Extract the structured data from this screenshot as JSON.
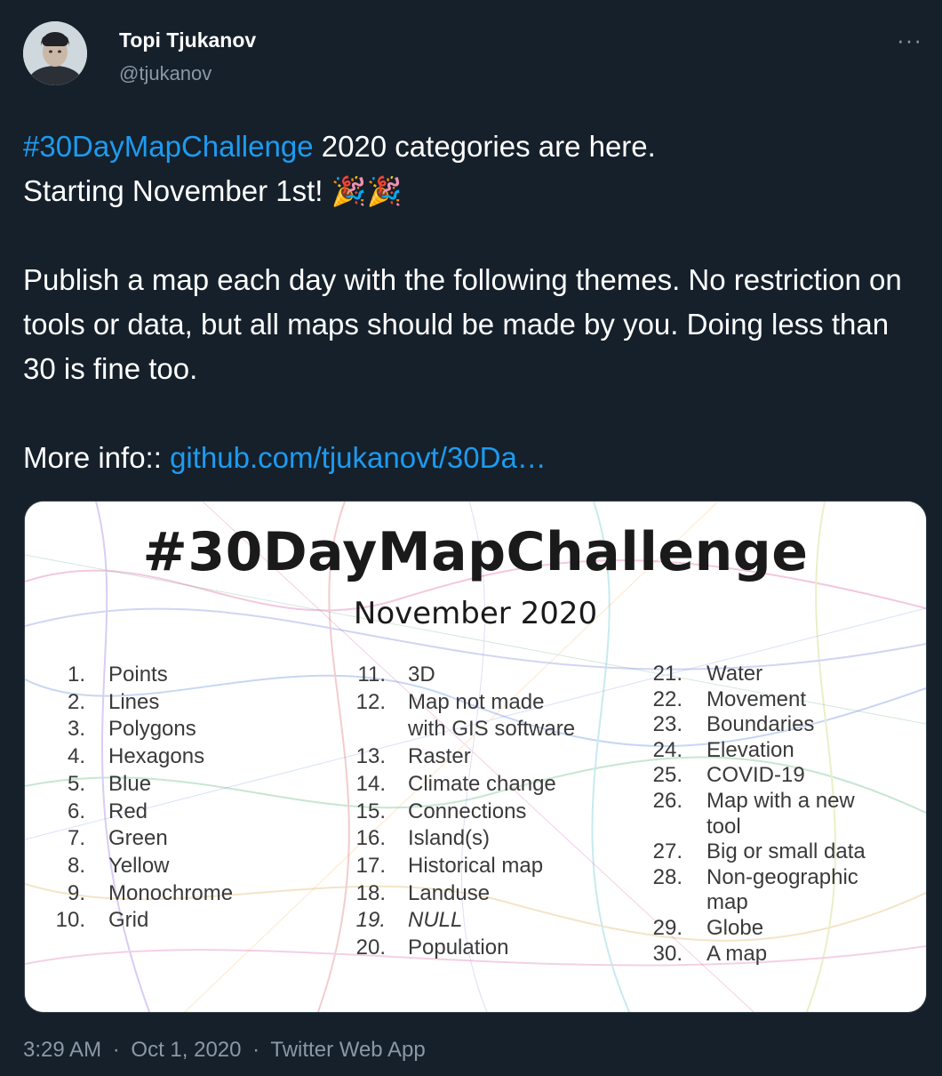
{
  "author": {
    "name": "Topi Tjukanov",
    "handle": "@tjukanov",
    "more_label": "···"
  },
  "tweet": {
    "hashtag": "#30DayMapChallenge",
    "line1_rest": " 2020 categories are here.",
    "line2": "Starting November 1st! ",
    "emoji": "🎉🎉",
    "para2": "Publish a map each day with the following themes. No restriction on tools or data, but all maps should be made by you. Doing less than 30 is fine too.",
    "more_info_label": "More info:: ",
    "link_text": "github.com/tjukanovt/30Da…"
  },
  "card": {
    "title": "#30DayMapChallenge",
    "subtitle": "November 2020",
    "col1": [
      {
        "num": "1.",
        "label": "Points"
      },
      {
        "num": "2.",
        "label": "Lines"
      },
      {
        "num": "3.",
        "label": "Polygons"
      },
      {
        "num": "4.",
        "label": "Hexagons"
      },
      {
        "num": "5.",
        "label": "Blue"
      },
      {
        "num": "6.",
        "label": "Red"
      },
      {
        "num": "7.",
        "label": "Green"
      },
      {
        "num": "8.",
        "label": "Yellow"
      },
      {
        "num": "9.",
        "label": "Monochrome"
      },
      {
        "num": "10.",
        "label": "Grid"
      }
    ],
    "col2": [
      {
        "num": "11.",
        "label": "3D"
      },
      {
        "num": "12.",
        "label": "Map not made"
      },
      {
        "num": "",
        "label": "with GIS software"
      },
      {
        "num": "13.",
        "label": "Raster"
      },
      {
        "num": "14.",
        "label": "Climate change"
      },
      {
        "num": "15.",
        "label": "Connections"
      },
      {
        "num": "16.",
        "label": "Island(s)"
      },
      {
        "num": "17.",
        "label": "Historical map"
      },
      {
        "num": "18.",
        "label": "Landuse"
      },
      {
        "num": "19.",
        "label": "NULL"
      },
      {
        "num": "20.",
        "label": "Population"
      }
    ],
    "col3": [
      {
        "num": "21.",
        "label": "Water"
      },
      {
        "num": "22.",
        "label": "Movement"
      },
      {
        "num": "23.",
        "label": "Boundaries"
      },
      {
        "num": "24.",
        "label": "Elevation"
      },
      {
        "num": "25.",
        "label": "COVID-19"
      },
      {
        "num": "26.",
        "label": "Map with a new"
      },
      {
        "num": "",
        "label": "tool"
      },
      {
        "num": "27.",
        "label": "Big or small data"
      },
      {
        "num": "28.",
        "label": "Non-geographic"
      },
      {
        "num": "",
        "label": "map"
      },
      {
        "num": "29.",
        "label": "Globe"
      },
      {
        "num": "30.",
        "label": "A map"
      }
    ]
  },
  "meta": {
    "time": "3:29 AM",
    "sep1": "·",
    "date": "Oct 1, 2020",
    "sep2": "·",
    "source": "Twitter Web App"
  },
  "colors": {
    "background": "#15202b",
    "link": "#1d9bf0",
    "muted": "#8b98a5"
  }
}
